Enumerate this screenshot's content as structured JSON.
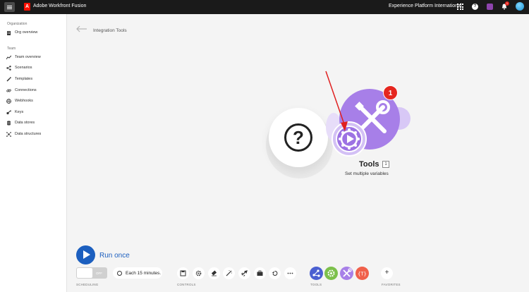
{
  "topbar": {
    "brand": "Adobe Workfront Fusion",
    "org": "Experience Platform International",
    "notification_count": "1"
  },
  "sidebar": {
    "section_org": "Organization",
    "section_team": "Team",
    "org_items": [
      {
        "label": "Org overview",
        "icon": "building-icon"
      }
    ],
    "team_items": [
      {
        "label": "Team overview",
        "icon": "chart-line-icon"
      },
      {
        "label": "Scenarios",
        "icon": "share-icon"
      },
      {
        "label": "Templates",
        "icon": "wand-icon"
      },
      {
        "label": "Connections",
        "icon": "link-icon"
      },
      {
        "label": "Webhooks",
        "icon": "globe-icon"
      },
      {
        "label": "Keys",
        "icon": "key-icon"
      },
      {
        "label": "Data stores",
        "icon": "database-icon"
      },
      {
        "label": "Data structures",
        "icon": "structure-icon"
      }
    ]
  },
  "main": {
    "page_title": "Integration Tools"
  },
  "canvas": {
    "unknown_module_symbol": "?",
    "tools_module": {
      "title": "Tools",
      "index": "1",
      "subtitle": "Set multiple variables",
      "badge": "1",
      "color": "#a77fe8"
    }
  },
  "bottom": {
    "run_once": "Run once",
    "toggle_state": "OFF",
    "schedule": "Each 15 minutes.",
    "labels": {
      "scheduling": "SCHEDULING",
      "controls": "CONTROLS",
      "tools": "TOOLS",
      "favorites": "FAVORITES"
    },
    "controls": [
      "save-icon",
      "gear-icon",
      "eraser-icon",
      "magic-wand-icon",
      "airplane-icon",
      "briefcase-icon",
      "undo-icon",
      "more-icon"
    ],
    "tools": [
      {
        "name": "flow-control-icon",
        "color": "#4a5fd1"
      },
      {
        "name": "gear-green-icon",
        "color": "#7cc04b"
      },
      {
        "name": "tools-icon",
        "color": "#a77fe8"
      },
      {
        "name": "text-parser-icon",
        "color": "#f0604a"
      }
    ],
    "favorites_add": "+"
  },
  "colors": {
    "accent": "#1c5fbf",
    "annotation_arrow": "#e02020"
  }
}
